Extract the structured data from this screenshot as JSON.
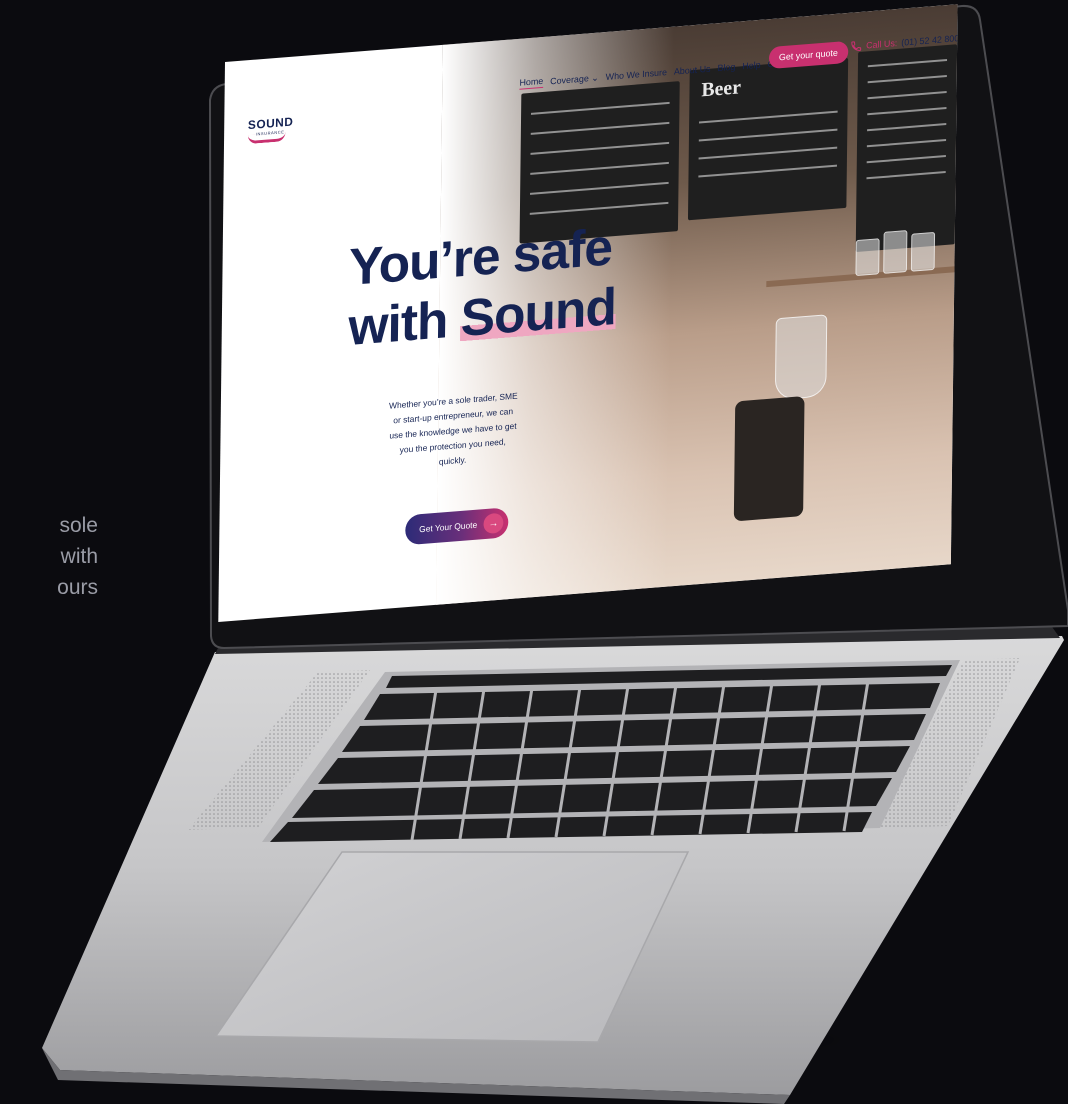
{
  "side_copy": {
    "line1": "h sole",
    "line2": "ely with",
    "line3": "ours"
  },
  "site": {
    "logo": {
      "name": "SOUND",
      "sub": "INSURANCE"
    },
    "nav": [
      "Home",
      "Coverage",
      "Who We Insure",
      "About Us",
      "Blog",
      "Help",
      "Contact"
    ],
    "nav_active": "Home",
    "quote_button": "Get your quote",
    "call_label": "Call Us:",
    "call_number": "(01) 52 42 800",
    "headline_line1": "You’re safe",
    "headline_line2_prefix": "with ",
    "headline_line2_highlight": "Sound",
    "intro": "Whether you’re a sole trader, SME or start-up entrepreneur, we can use the knowledge we have to get you the protection you need, quickly.",
    "cta_label": "Get Your Quote",
    "cta_icon": "arrow-right-icon",
    "chalkboard_heading": "Beer"
  },
  "colors": {
    "navy": "#152353",
    "pink": "#c8306f",
    "highlight": "#efa7c1",
    "background": "#0b0b0f"
  }
}
